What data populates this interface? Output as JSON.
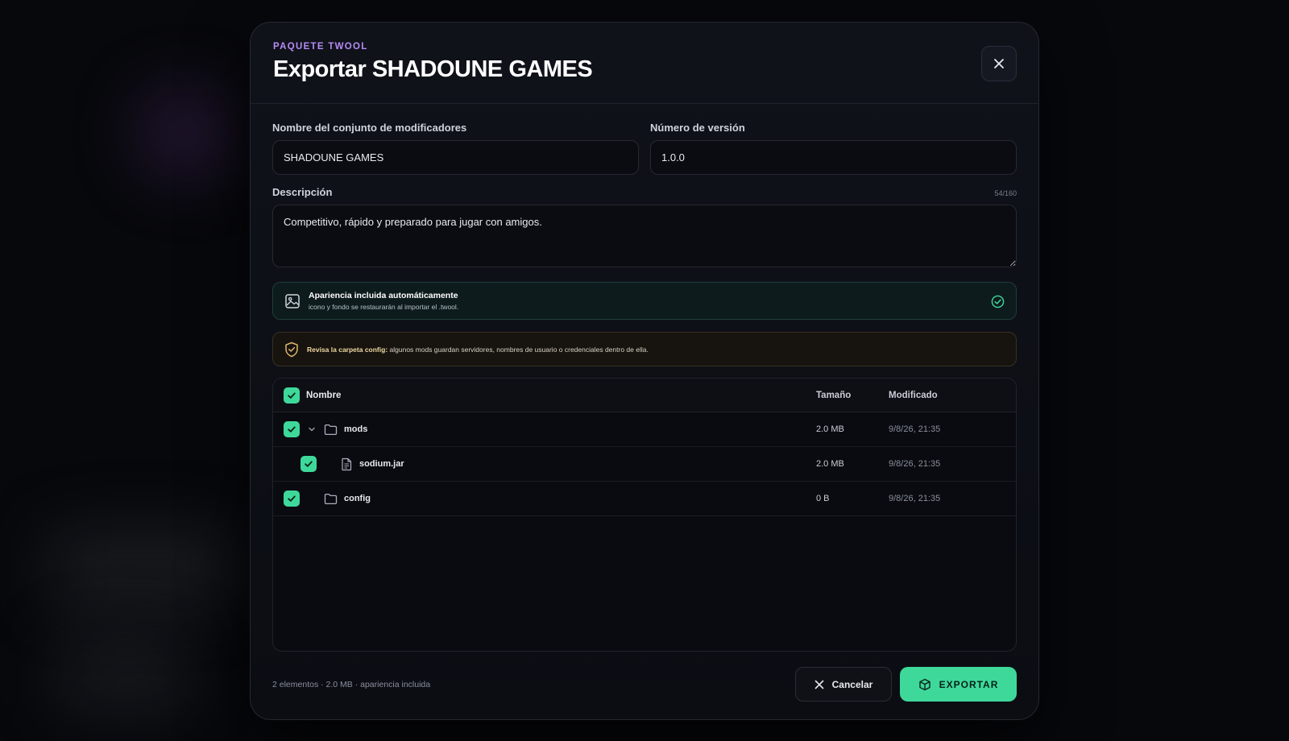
{
  "header": {
    "eyebrow": "PAQUETE TWOOL",
    "title": "Exportar SHADOUNE GAMES"
  },
  "form": {
    "name_label": "Nombre del conjunto de modificadores",
    "name_value": "SHADOUNE GAMES",
    "version_label": "Número de versión",
    "version_value": "1.0.0",
    "description_label": "Descripción",
    "description_counter": "54/160",
    "description_value": "Competitivo, rápido y preparado para jugar con amigos."
  },
  "appearance_notice": {
    "title": "Apariencia incluida automáticamente",
    "subtitle": "icono y fondo se restaurarán al importar el .twool."
  },
  "warning_notice": {
    "bold": "Revisa la carpeta config:",
    "text": " algunos mods guardan servidores, nombres de usuario o credenciales dentro de ella."
  },
  "table": {
    "headers": {
      "name": "Nombre",
      "size": "Tamaño",
      "modified": "Modificado"
    },
    "rows": [
      {
        "name": "mods",
        "size": "2.0 MB",
        "modified": "9/8/26, 21:35",
        "type": "folder",
        "expanded": true,
        "depth": 0,
        "checked": true
      },
      {
        "name": "sodium.jar",
        "size": "2.0 MB",
        "modified": "9/8/26, 21:35",
        "type": "file",
        "depth": 1,
        "checked": true
      },
      {
        "name": "config",
        "size": "0 B",
        "modified": "9/8/26, 21:35",
        "type": "folder",
        "expanded": false,
        "depth": 0,
        "checked": true
      }
    ]
  },
  "footer": {
    "summary": "2 elementos · 2.0 MB · apariencia incluida",
    "cancel_label": "Cancelar",
    "export_label": "EXPORTAR"
  },
  "colors": {
    "accent_green": "#3ed99a",
    "eyebrow_purple": "#b58cf5",
    "warning_text": "#f0d8a2"
  },
  "icons": [
    "close-icon",
    "image-icon",
    "check-circle-icon",
    "shield-check-icon",
    "checkbox-check-icon",
    "chevron-down-icon",
    "folder-icon",
    "file-icon",
    "package-icon"
  ]
}
